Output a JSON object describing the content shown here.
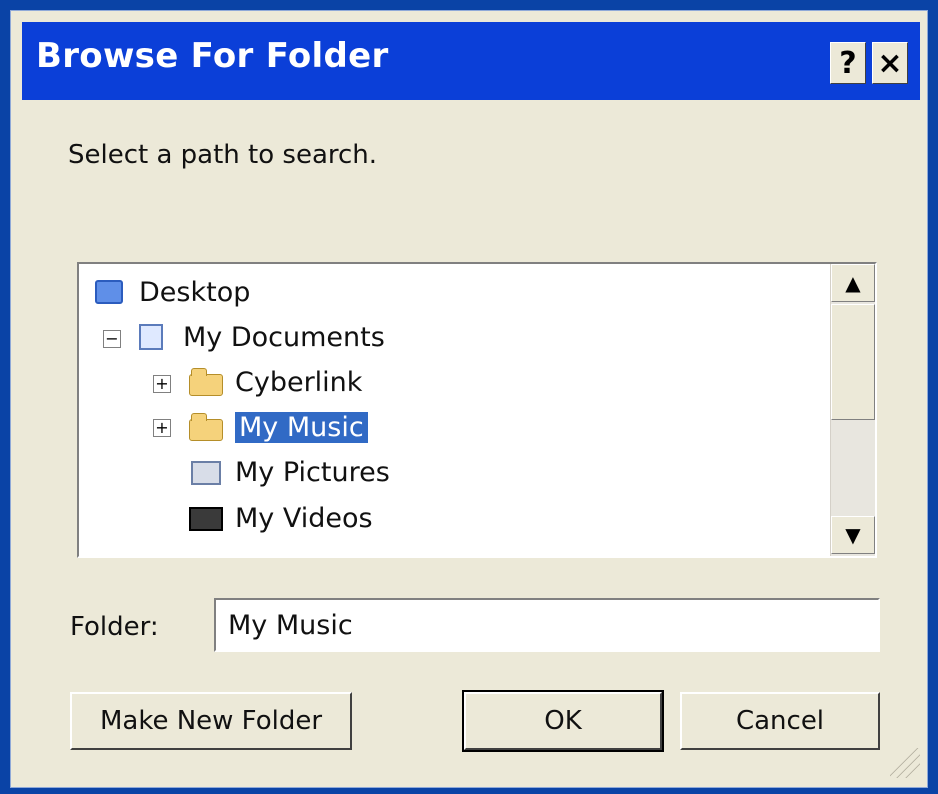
{
  "window": {
    "title": "Browse For Folder",
    "help_label": "?",
    "close_label": "×"
  },
  "prompt": "Select a path to search.",
  "tree": {
    "items": [
      {
        "label": "Desktop",
        "icon": "desktop-icon",
        "expander": ""
      },
      {
        "label": "My Documents",
        "icon": "documents-icon",
        "expander": "−"
      },
      {
        "label": "Cyberlink",
        "icon": "folder-icon",
        "expander": "+"
      },
      {
        "label": "My Music",
        "icon": "music-folder-icon",
        "expander": "+",
        "selected": true
      },
      {
        "label": "My Pictures",
        "icon": "pictures-icon",
        "expander": ""
      },
      {
        "label": "My Videos",
        "icon": "videos-icon",
        "expander": ""
      }
    ]
  },
  "folder_field": {
    "label": "Folder:",
    "value": "My Music"
  },
  "buttons": {
    "make_new_folder": "Make New Folder",
    "ok": "OK",
    "cancel": "Cancel"
  },
  "colors": {
    "titlebar": "#0b3fd8",
    "dialog_bg": "#ece9d8",
    "selection": "#316ac5"
  }
}
